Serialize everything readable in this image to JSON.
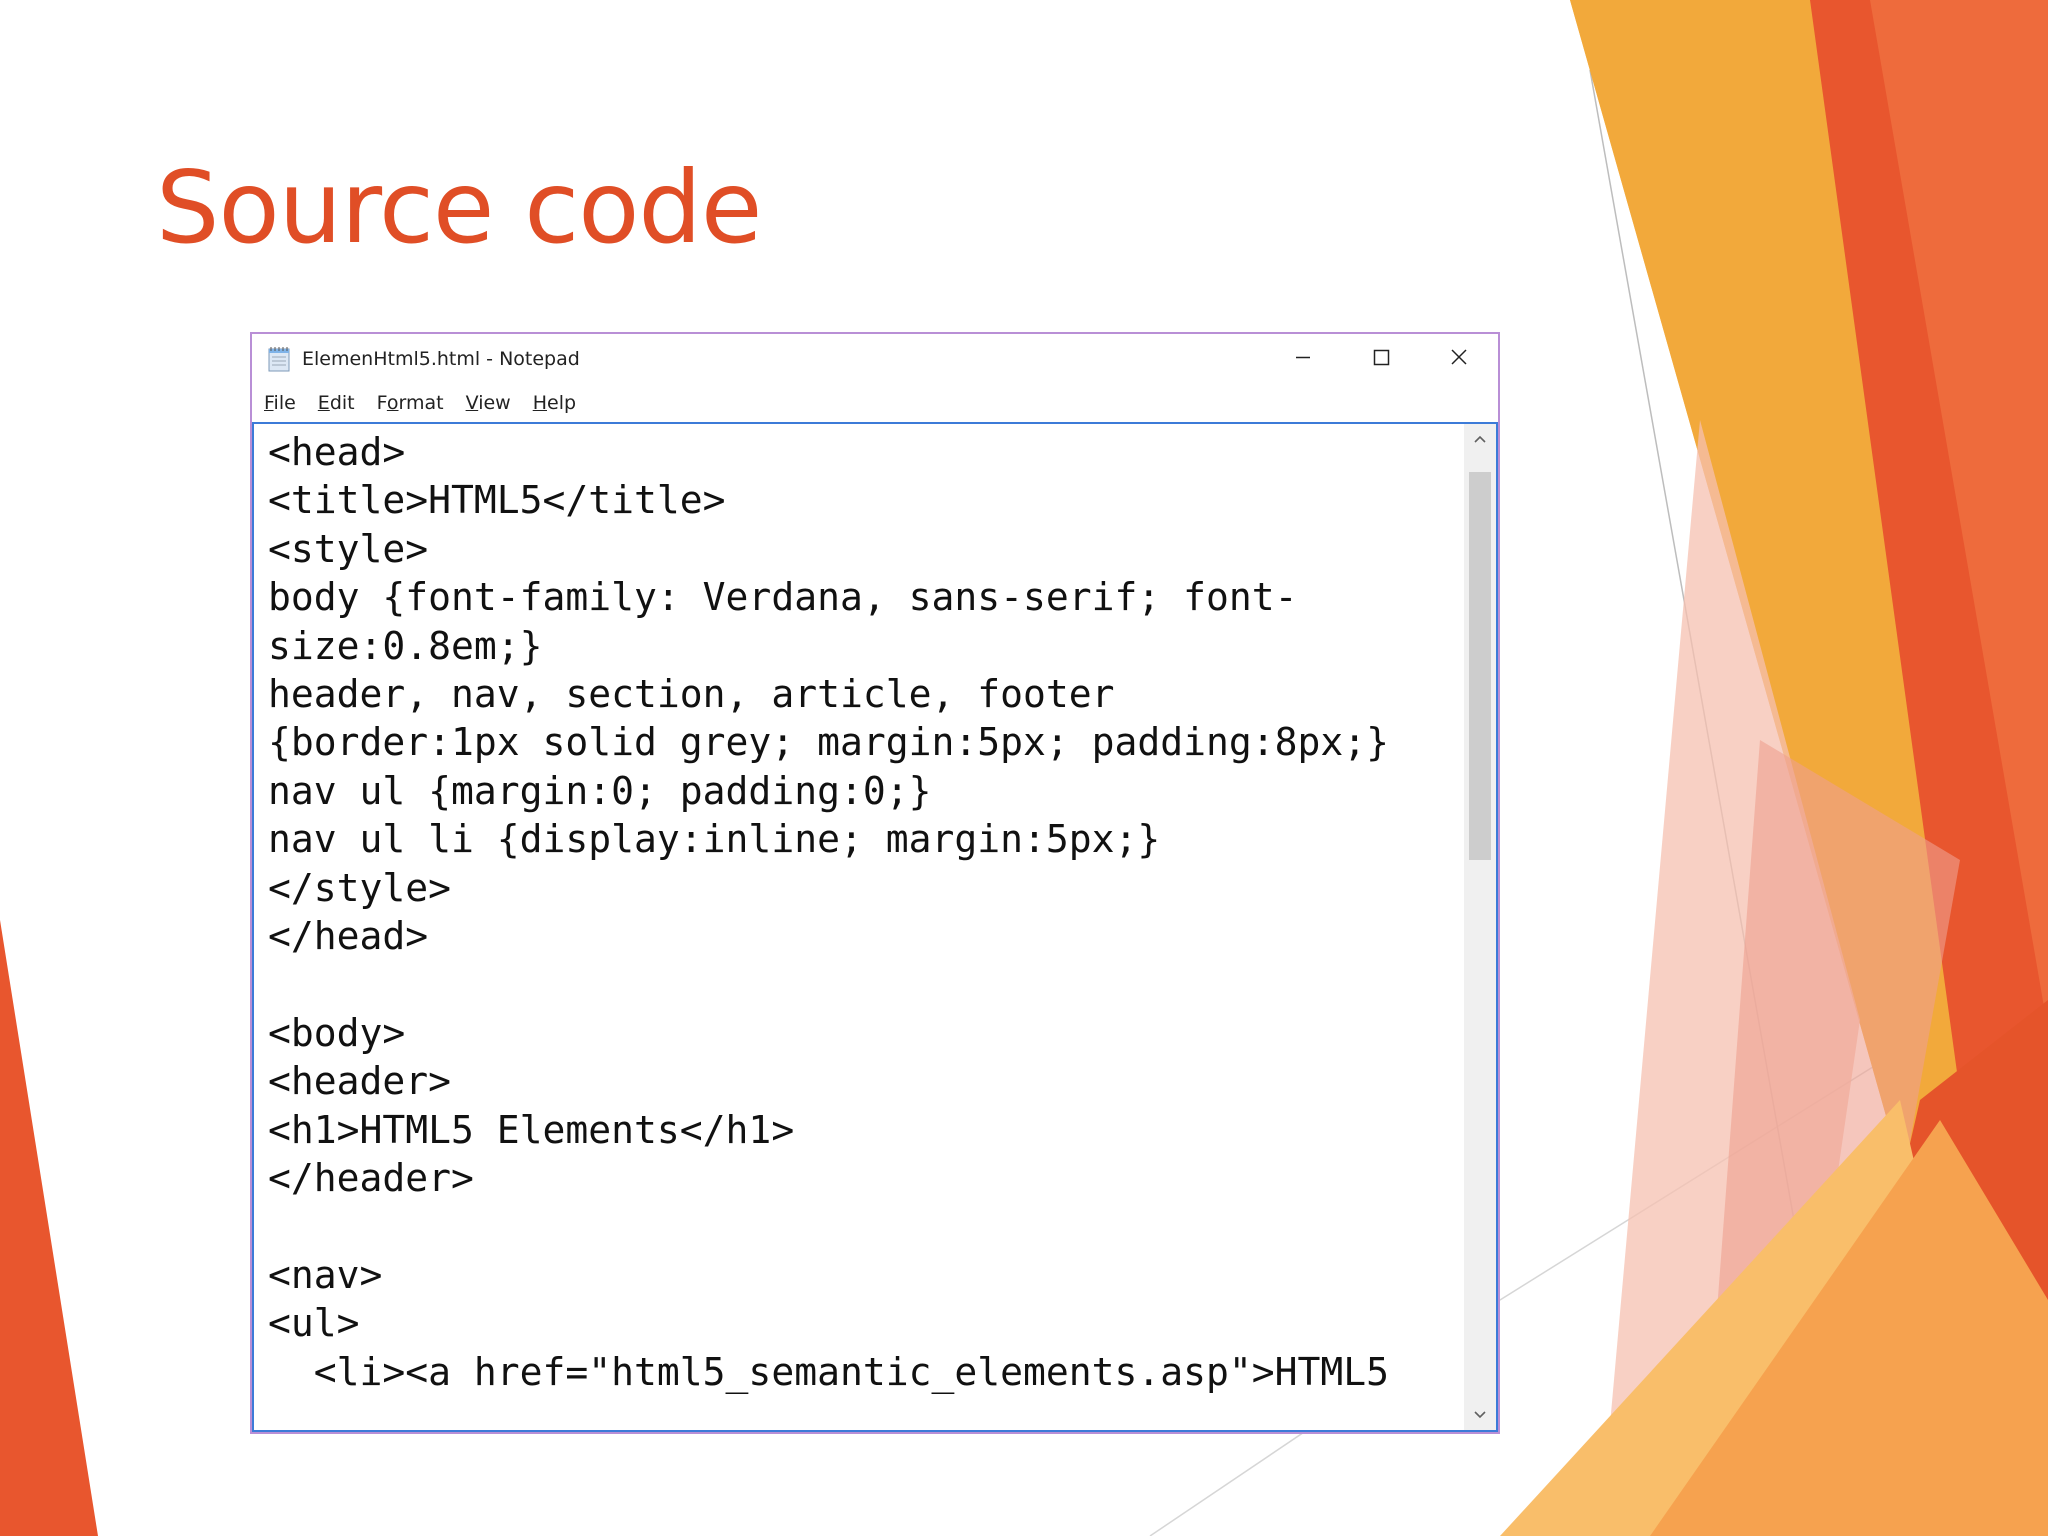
{
  "slide": {
    "title": "Source code"
  },
  "notepad": {
    "app_icon": "notepad-icon",
    "window_title": "ElemenHtml5.html - Notepad",
    "controls": {
      "minimize_icon": "minimize-icon",
      "maximize_icon": "maximize-icon",
      "close_icon": "close-icon"
    },
    "menu": [
      {
        "key": "F",
        "rest": "ile"
      },
      {
        "key": "E",
        "rest": "dit"
      },
      {
        "pre": "F",
        "key": "o",
        "rest": "rmat"
      },
      {
        "key": "V",
        "rest": "iew"
      },
      {
        "key": "H",
        "rest": "elp"
      }
    ],
    "content": "<head>\n<title>HTML5</title>\n<style>\nbody {font-family: Verdana, sans-serif; font-\nsize:0.8em;}\nheader, nav, section, article, footer\n{border:1px solid grey; margin:5px; padding:8px;}\nnav ul {margin:0; padding:0;}\nnav ul li {display:inline; margin:5px;}\n</style>\n</head>\n\n<body>\n<header>\n<h1>HTML5 Elements</h1>\n</header>\n\n<nav>\n<ul>\n  <li><a href=\"html5_semantic_elements.asp\">HTML5",
    "scrollbar": {
      "up_icon": "scroll-up-arrow-icon",
      "down_icon": "scroll-down-arrow-icon",
      "position": 0.0
    }
  },
  "theme": {
    "title_color": "#E04E26",
    "accent_orange": "#F2A93B",
    "accent_red": "#E8562E",
    "window_border": "#B98FD6",
    "editor_border": "#3C7BD8"
  }
}
